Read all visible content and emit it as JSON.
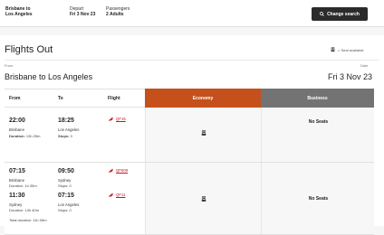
{
  "topbar": {
    "route_label": "Brisbane to",
    "route_value": "Los Angeles",
    "depart_label": "Depart",
    "depart_value": "Fri 3 Nov 23",
    "passengers_label": "Passengers",
    "passengers_value": "2 Adults",
    "change_search": "Change search"
  },
  "main": {
    "title": "Flights Out",
    "seat_legend": "= Seat available",
    "from_label": "From",
    "route": "Brisbane to Los Angeles",
    "date_label": "Date",
    "date_value": "Fri 3 Nov 23"
  },
  "table": {
    "headers": {
      "from": "From",
      "to": "To",
      "flight": "Flight",
      "economy": "Economy",
      "business": "Business"
    },
    "rows": [
      {
        "dep_time": "22:00",
        "dep_place": "Brisbane",
        "duration_label": "Duration:",
        "duration": "13h 25m",
        "arr_time": "18:25",
        "arr_place": "Los Angeles",
        "stops_label": "Stops:",
        "stops": "0",
        "flight": "QF15",
        "business": "No Seats"
      },
      {
        "leg1_dep_time": "07:15",
        "leg1_dep_place": "Brisbane",
        "leg1_duration": "Duration: 1h 35m",
        "leg1_arr_time": "09:50",
        "leg1_arr_place": "Sydney",
        "leg1_stops": "Stops: 0",
        "leg1_flight": "QF509",
        "leg2_dep_time": "11:30",
        "leg2_dep_place": "Sydney",
        "leg2_duration": "Duration: 13h 40m",
        "leg2_arr_time": "07:15",
        "leg2_arr_place": "Los Angeles",
        "leg2_stops": "Stops: 0",
        "leg2_flight": "QF11",
        "total_label": "Total duration:",
        "total": "11h 05m",
        "business": "No Seats"
      }
    ]
  },
  "colors": {
    "economy_header": "#c5501b",
    "business_header": "#737373",
    "flight_link": "#c4161c"
  },
  "icons": [
    "search-icon",
    "seat-icon",
    "qantas-kangaroo-icon"
  ]
}
